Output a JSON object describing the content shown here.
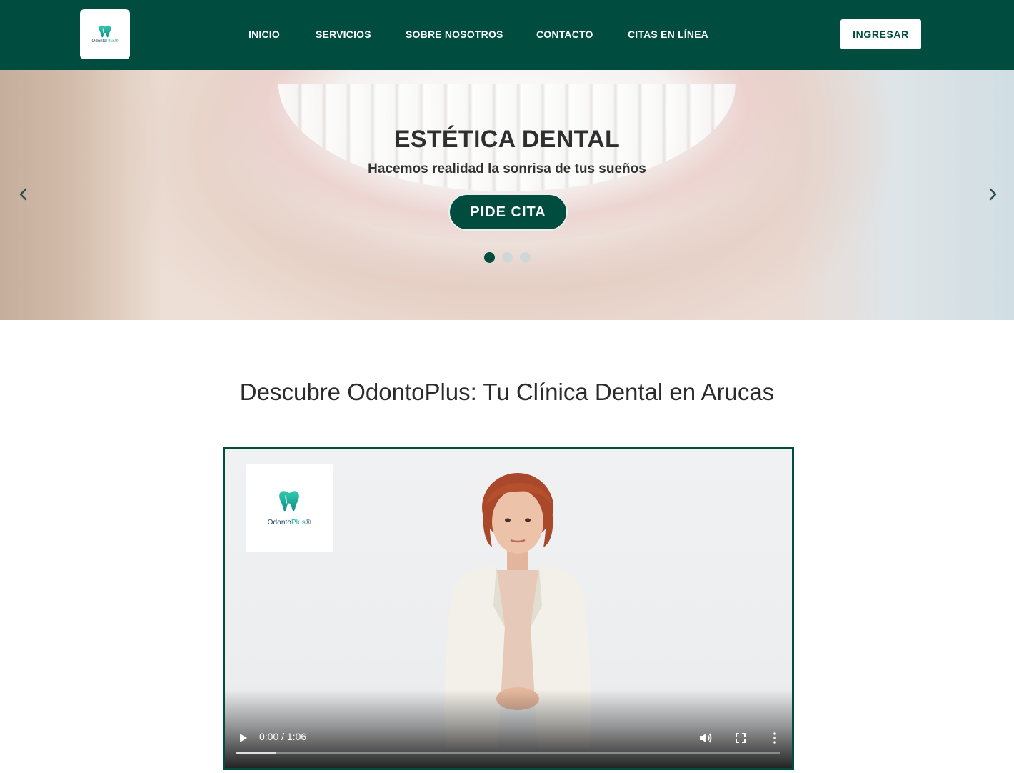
{
  "brand": {
    "name_part1": "Odonto",
    "name_part2": "Plus",
    "mark": "®",
    "primary_color": "#004d40",
    "accent_color": "#1fb5a0"
  },
  "nav": {
    "items": [
      {
        "label": "INICIO"
      },
      {
        "label": "SERVICIOS"
      },
      {
        "label": "SOBRE NOSOTROS"
      },
      {
        "label": "CONTACTO"
      },
      {
        "label": "CITAS EN LÍNEA"
      }
    ],
    "login_label": "INGRESAR"
  },
  "hero": {
    "title": "ESTÉTICA DENTAL",
    "subtitle": "Hacemos realidad la sonrisa de tus sueños",
    "cta_label": "PIDE CITA",
    "slide_count": 3,
    "active_slide": 1,
    "prev_icon": "chevron-left-icon",
    "next_icon": "chevron-right-icon"
  },
  "section": {
    "title": "Descubre OdontoPlus: Tu Clínica Dental en Arucas"
  },
  "video": {
    "time_display": "0:00 / 1:06",
    "current_time": "0:00",
    "duration": "1:06",
    "buffered_fraction": 0.074,
    "icons": [
      "play-icon",
      "volume-icon",
      "fullscreen-icon",
      "more-options-icon"
    ]
  }
}
